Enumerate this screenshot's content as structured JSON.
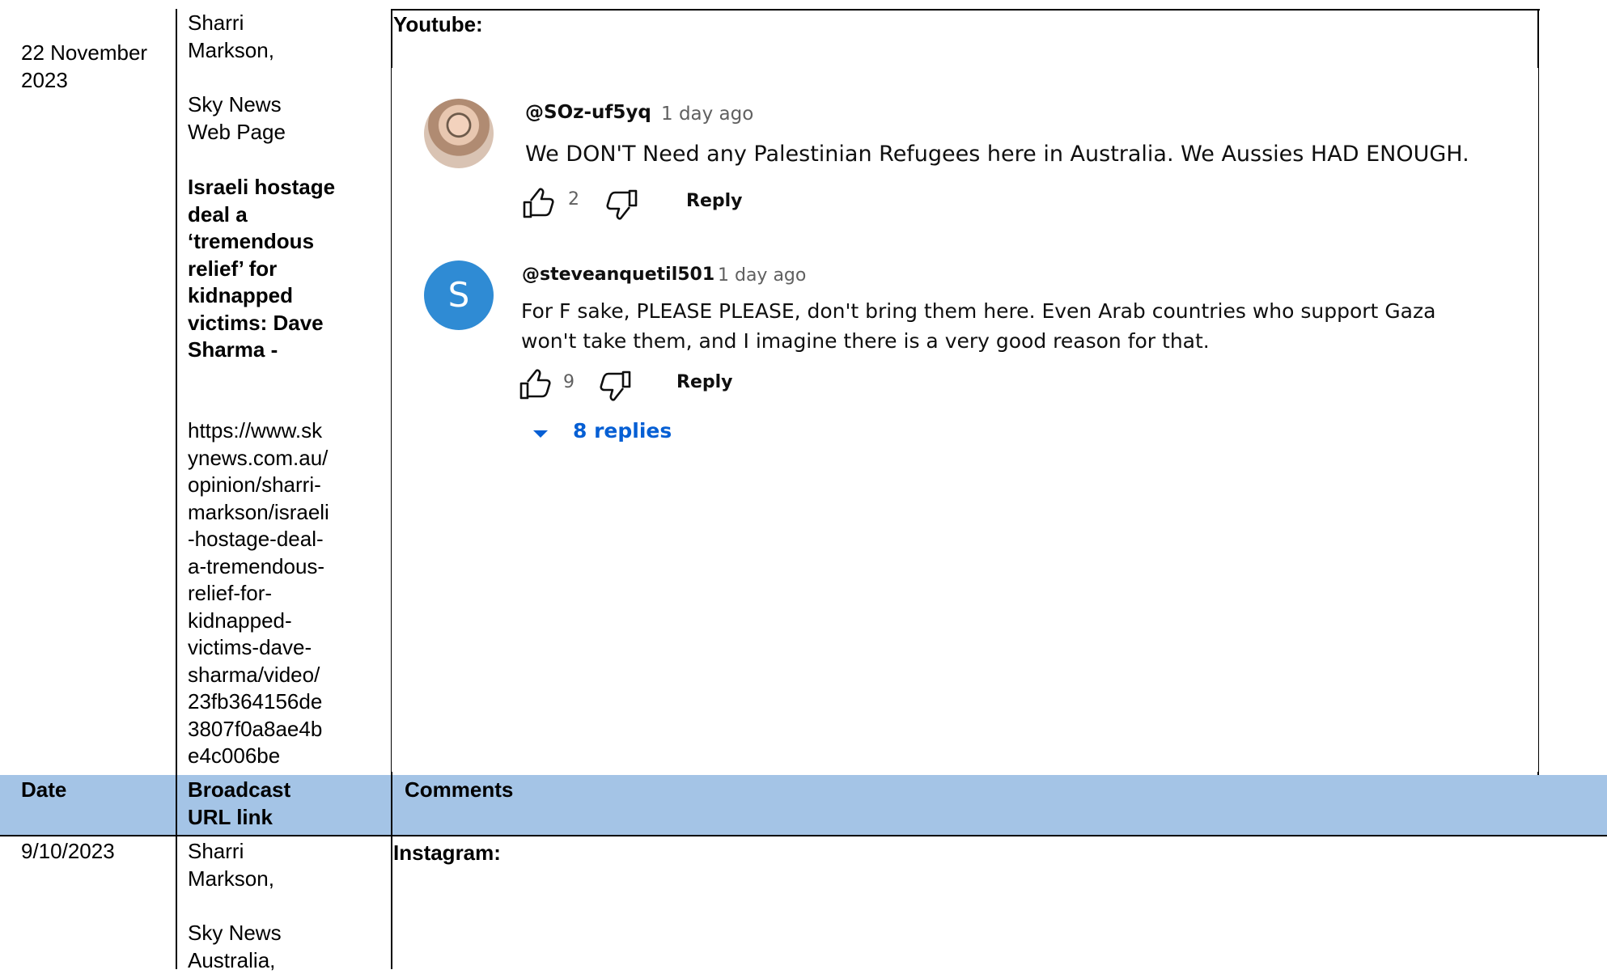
{
  "row1": {
    "date": "22 November 2023",
    "presenter": "Sharri Markson,",
    "outlet": "Sky News Web Page",
    "headline": "Israeli hostage deal a ‘tremendous relief’ for kidnapped victims: Dave Sharma -",
    "url_lines": [
      "https://www.sk",
      "ynews.com.au/",
      "opinion/sharri-",
      "markson/israeli",
      "-hostage-deal-",
      "a-tremendous-",
      "relief-for-",
      "kidnapped-",
      "victims-dave-",
      "sharma/video/",
      "23fb364156de",
      "3807f0a8ae4b",
      "e4c006be"
    ],
    "platform": "Youtube:"
  },
  "youtube_comments": [
    {
      "handle": "@SOz-uf5yq",
      "time": "1 day ago",
      "text": "We DON'T Need any Palestinian Refugees here in Australia. We Aussies HAD ENOUGH.",
      "likes": "2",
      "reply_label": "Reply",
      "avatar": "photo"
    },
    {
      "handle": "@steveanquetil501",
      "time": "1 day ago",
      "text_line1": "For F sake, PLEASE PLEASE, don't bring them here. Even Arab countries who support Gaza",
      "text_line2": "won't take them, and I imagine there is a very good reason for that.",
      "likes": "9",
      "reply_label": "Reply",
      "avatar_letter": "S",
      "replies_toggle": "8 replies"
    }
  ],
  "header": {
    "col1": "Date",
    "col2_line1": "Broadcast",
    "col2_line2": "URL link",
    "col3": "Comments"
  },
  "row2": {
    "date": "9/10/2023",
    "presenter_line1": "Sharri",
    "presenter_line2": "Markson,",
    "outlet_line1": "Sky News",
    "outlet_line2": "Australia,",
    "platform": "Instagram:"
  },
  "colors": {
    "header_bg": "#a4c4e6",
    "link_blue": "#065fd4",
    "avatar_blue": "#2f8bd4"
  },
  "icons": [
    "thumbs-up-icon",
    "thumbs-down-icon",
    "caret-down-icon"
  ]
}
